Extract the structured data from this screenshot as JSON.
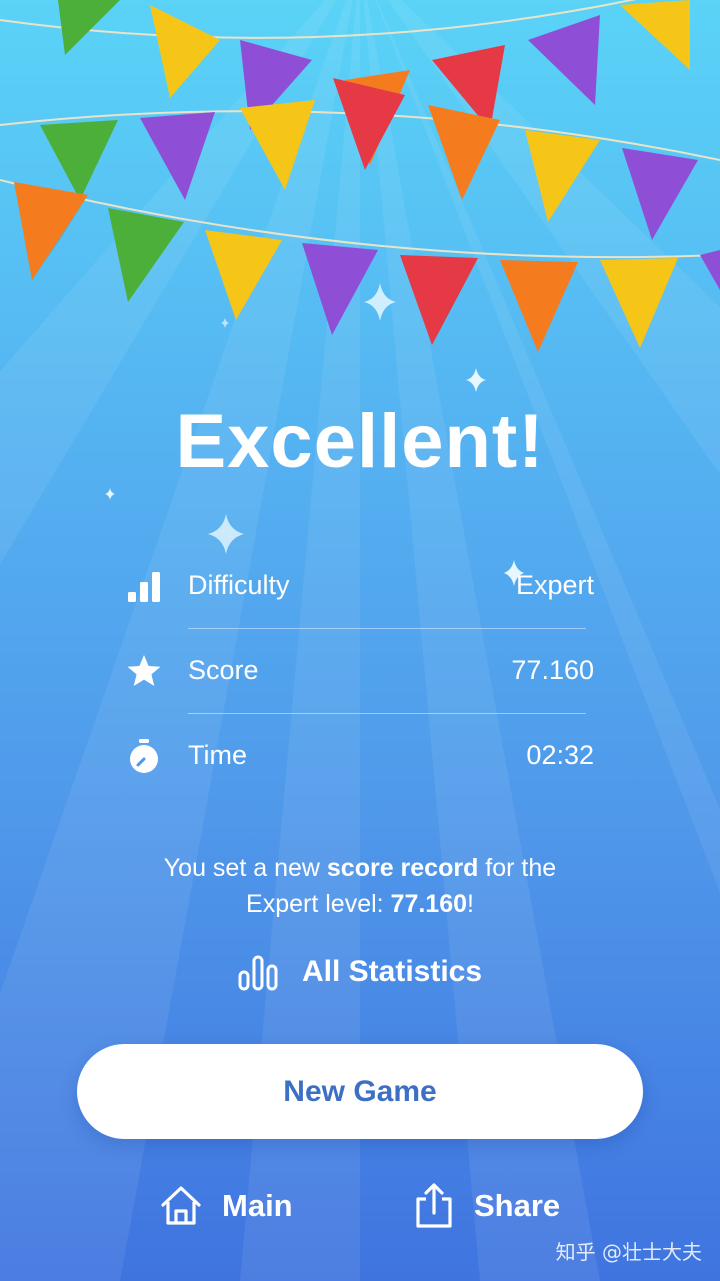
{
  "screen": {
    "title": "Excellent!",
    "stats": [
      {
        "label": "Difficulty",
        "value": "Expert",
        "icon": "signal-bars-icon"
      },
      {
        "label": "Score",
        "value": "77.160",
        "icon": "star-icon"
      },
      {
        "label": "Time",
        "value": "02:32",
        "icon": "stopwatch-icon"
      }
    ],
    "record": {
      "part1": "You set a new ",
      "bold1": "score record",
      "part2": " for the",
      "part3": "Expert level: ",
      "bold2": "77.160",
      "part4": "!"
    },
    "all_statistics_label": "All Statistics",
    "new_game_label": "New Game",
    "nav": {
      "main_label": "Main",
      "share_label": "Share"
    },
    "watermark": "知乎 @壮士大夫"
  },
  "colors": {
    "background_top": "#5ad3f7",
    "background_bottom": "#3f74df",
    "button_text": "#3d6fc4",
    "flag_colors": [
      "#4caf3a",
      "#f5c518",
      "#8e4fd6",
      "#e53946",
      "#f57c1e"
    ]
  }
}
